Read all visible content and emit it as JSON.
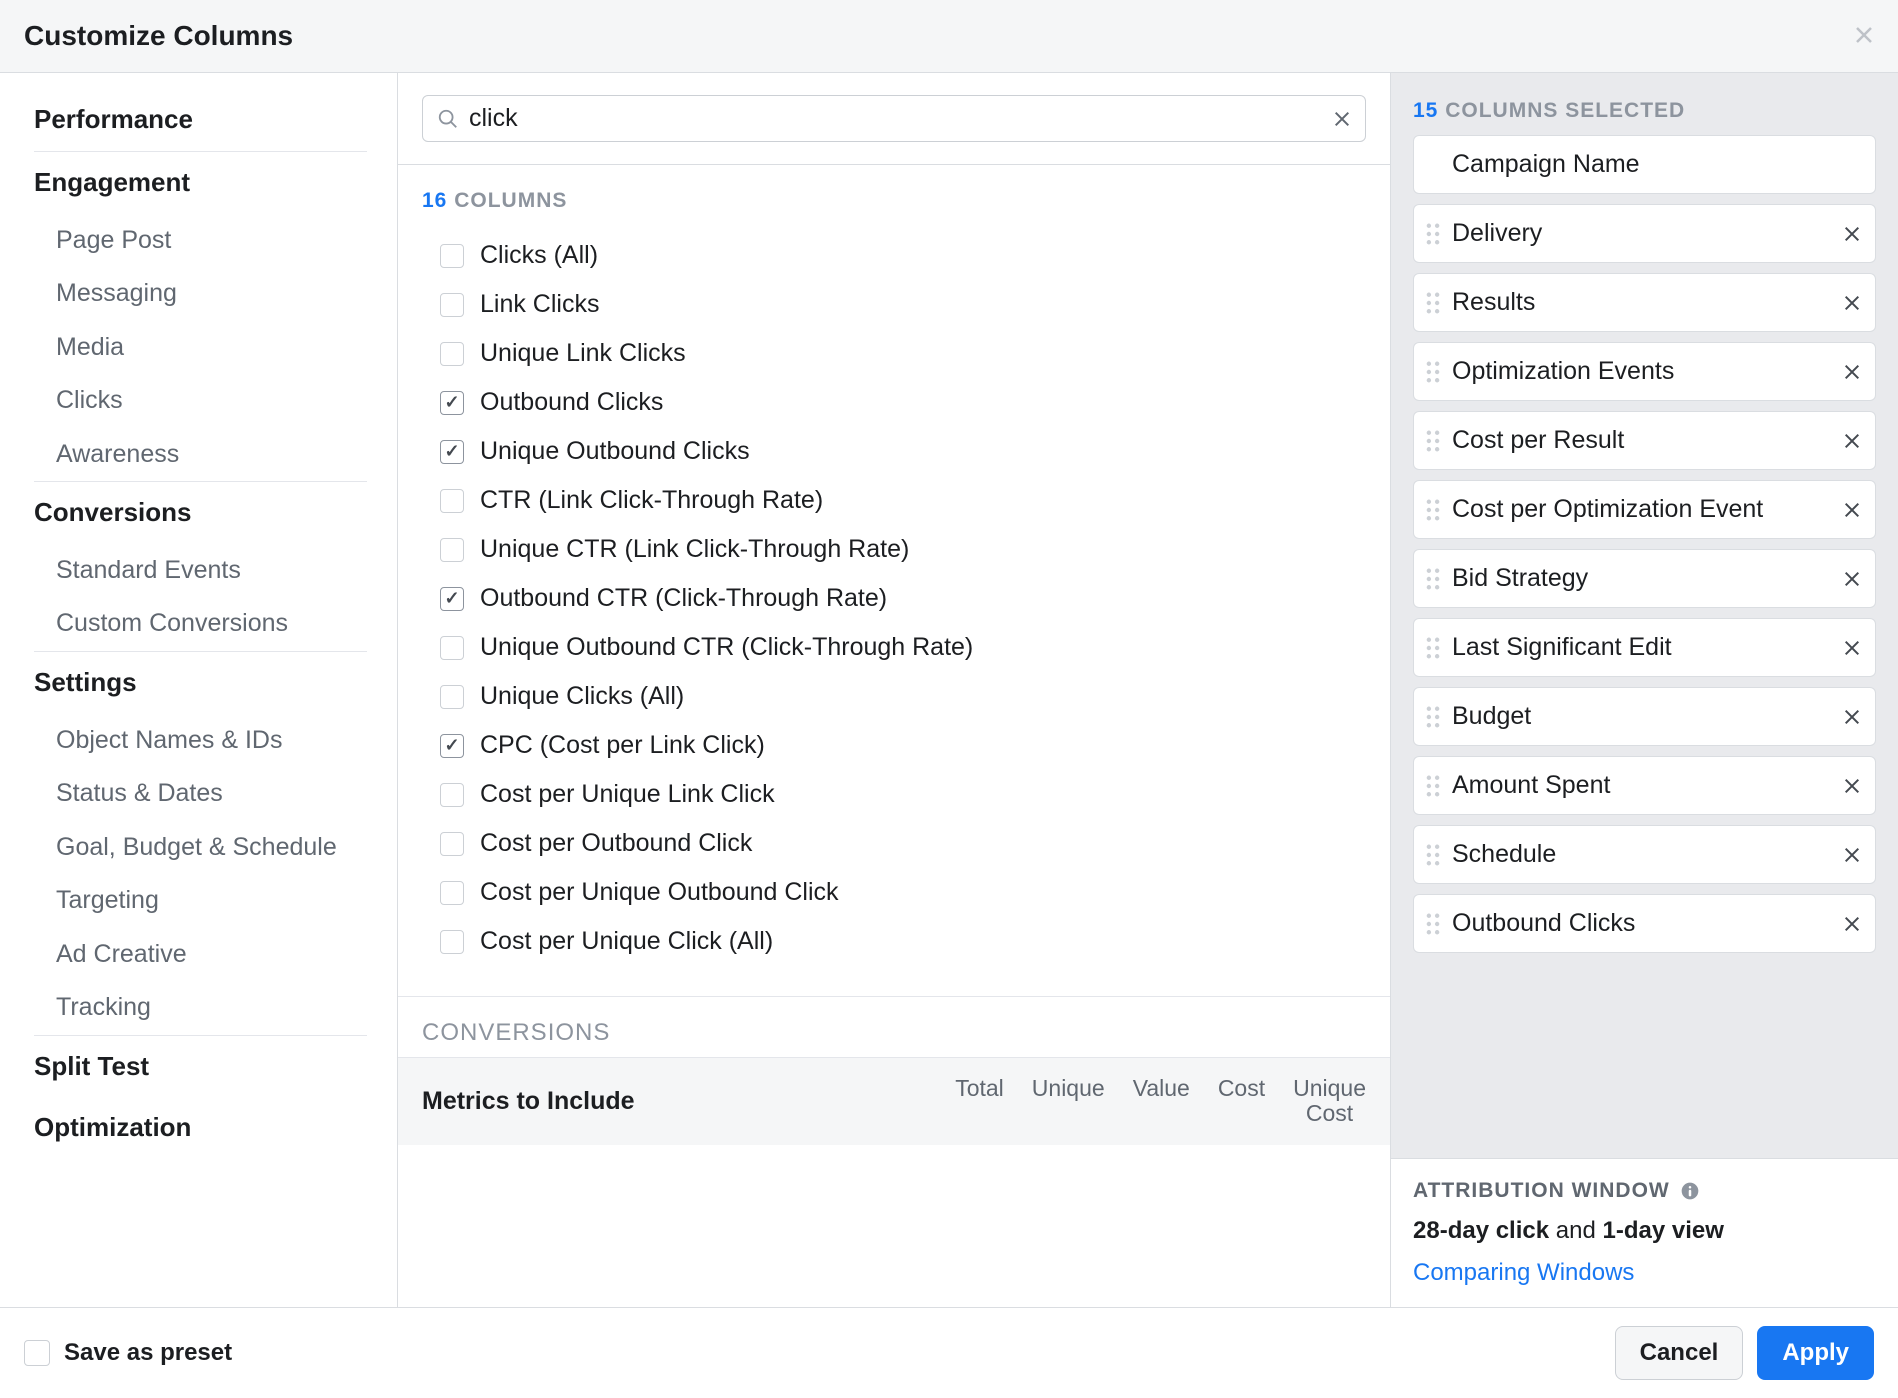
{
  "header": {
    "title": "Customize Columns"
  },
  "sidebar": {
    "sections": [
      {
        "cat": "Performance",
        "items": []
      },
      {
        "cat": "Engagement",
        "items": [
          "Page Post",
          "Messaging",
          "Media",
          "Clicks",
          "Awareness"
        ]
      },
      {
        "cat": "Conversions",
        "items": [
          "Standard Events",
          "Custom Conversions"
        ]
      },
      {
        "cat": "Settings",
        "items": [
          "Object Names & IDs",
          "Status & Dates",
          "Goal, Budget & Schedule",
          "Targeting",
          "Ad Creative",
          "Tracking"
        ]
      },
      {
        "cat": "Split Test",
        "items": []
      },
      {
        "cat": "Optimization",
        "items": []
      }
    ]
  },
  "search": {
    "value": "click"
  },
  "columnsCount": {
    "num": "16",
    "label": "COLUMNS"
  },
  "columns": [
    {
      "label": "Clicks (All)",
      "checked": false
    },
    {
      "label": "Link Clicks",
      "checked": false
    },
    {
      "label": "Unique Link Clicks",
      "checked": false
    },
    {
      "label": "Outbound Clicks",
      "checked": true
    },
    {
      "label": "Unique Outbound Clicks",
      "checked": true
    },
    {
      "label": "CTR (Link Click-Through Rate)",
      "checked": false
    },
    {
      "label": "Unique CTR (Link Click-Through Rate)",
      "checked": false
    },
    {
      "label": "Outbound CTR (Click-Through Rate)",
      "checked": true
    },
    {
      "label": "Unique Outbound CTR (Click-Through Rate)",
      "checked": false
    },
    {
      "label": "Unique Clicks (All)",
      "checked": false
    },
    {
      "label": "CPC (Cost per Link Click)",
      "checked": true
    },
    {
      "label": "Cost per Unique Link Click",
      "checked": false
    },
    {
      "label": "Cost per Outbound Click",
      "checked": false
    },
    {
      "label": "Cost per Unique Outbound Click",
      "checked": false
    },
    {
      "label": "Cost per Unique Click (All)",
      "checked": false
    }
  ],
  "conversionsHeader": "CONVERSIONS",
  "metrics": {
    "title": "Metrics to Include",
    "cols": [
      "Total",
      "Unique",
      "Value",
      "Cost",
      "Unique\nCost"
    ]
  },
  "selected": {
    "num": "15",
    "label": "COLUMNS SELECTED",
    "items": [
      {
        "label": "Campaign Name",
        "draggable": false,
        "removable": false
      },
      {
        "label": "Delivery",
        "draggable": true,
        "removable": true
      },
      {
        "label": "Results",
        "draggable": true,
        "removable": true
      },
      {
        "label": "Optimization Events",
        "draggable": true,
        "removable": true
      },
      {
        "label": "Cost per Result",
        "draggable": true,
        "removable": true
      },
      {
        "label": "Cost per Optimization Event",
        "draggable": true,
        "removable": true
      },
      {
        "label": "Bid Strategy",
        "draggable": true,
        "removable": true
      },
      {
        "label": "Last Significant Edit",
        "draggable": true,
        "removable": true
      },
      {
        "label": "Budget",
        "draggable": true,
        "removable": true
      },
      {
        "label": "Amount Spent",
        "draggable": true,
        "removable": true
      },
      {
        "label": "Schedule",
        "draggable": true,
        "removable": true
      },
      {
        "label": "Outbound Clicks",
        "draggable": true,
        "removable": true
      }
    ]
  },
  "attribution": {
    "title": "ATTRIBUTION WINDOW",
    "textParts": [
      "28-day click",
      " and ",
      "1-day view"
    ],
    "link": "Comparing Windows"
  },
  "footer": {
    "preset": "Save as preset",
    "cancel": "Cancel",
    "apply": "Apply"
  }
}
